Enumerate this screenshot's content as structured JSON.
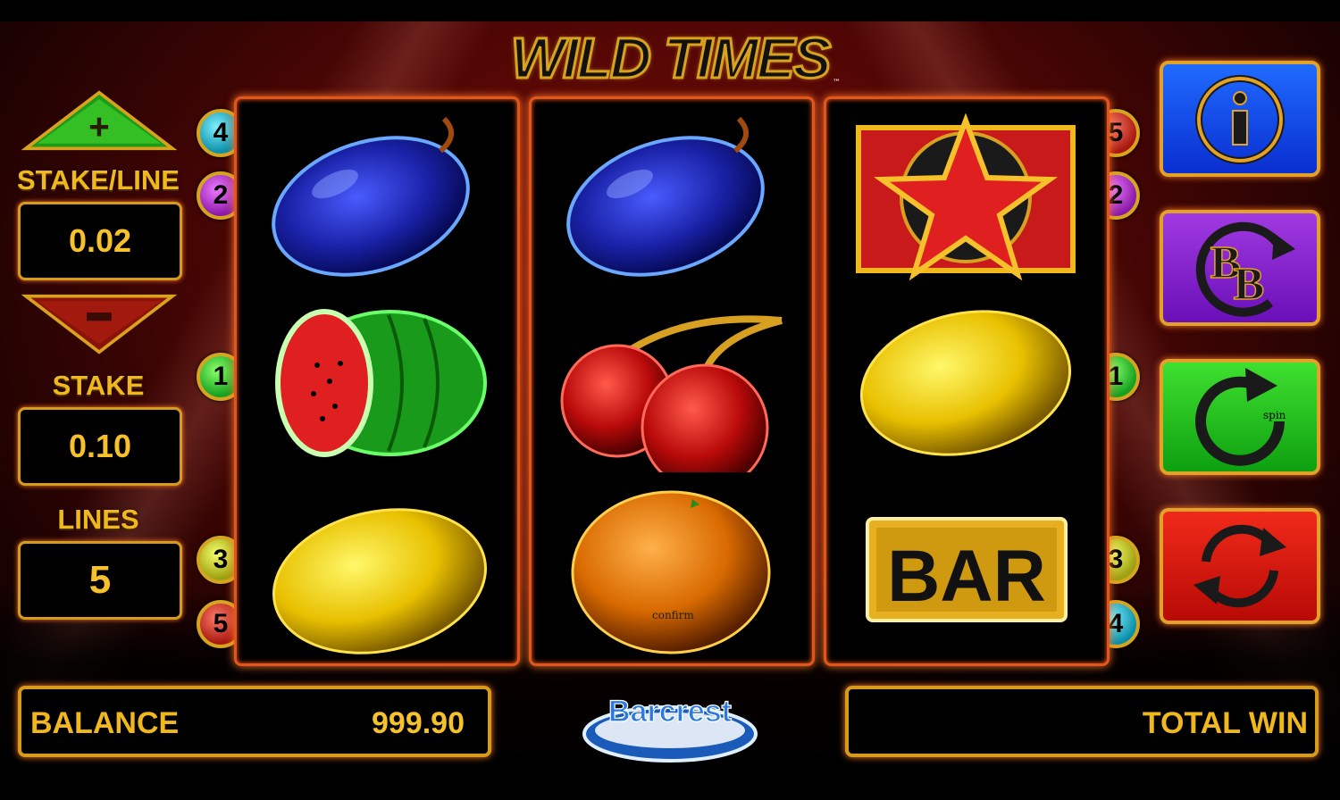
{
  "title": "WILD TIMES",
  "trademark": "™",
  "left_panel": {
    "plus_label": "+",
    "minus_label": "−",
    "stake_line_label": "STAKE/LINE",
    "stake_line_value": "0.02",
    "stake_label": "STAKE",
    "stake_value": "0.10",
    "lines_label": "LINES",
    "lines_value": "5"
  },
  "line_markers": {
    "left": [
      "4",
      "2",
      "1",
      "3",
      "5"
    ],
    "right": [
      "5",
      "2",
      "1",
      "3",
      "4"
    ]
  },
  "reels": [
    [
      "plum",
      "watermelon",
      "lemon"
    ],
    [
      "plum",
      "cherries",
      "orange"
    ],
    [
      "star",
      "lemon",
      "bar"
    ]
  ],
  "bar_text": "BAR",
  "buttons": {
    "info_icon": "info-icon",
    "bb_icon": "big-bet-icon",
    "spin_icon": "spin-icon",
    "spin_text": "spin",
    "autoplay_icon": "autoplay-icon"
  },
  "confirm_text": "confirm",
  "balance": {
    "label": "BALANCE",
    "value": "999.90"
  },
  "total_win": {
    "label": "TOTAL WIN"
  },
  "logo_text": "Barcrest",
  "colors": {
    "gold": "#f0b81c",
    "frame": "#e2551b",
    "info_blue": "#1f6aff",
    "bb_purple": "#a03ae0",
    "spin_green": "#3fe030",
    "auto_red": "#f02a1a"
  }
}
